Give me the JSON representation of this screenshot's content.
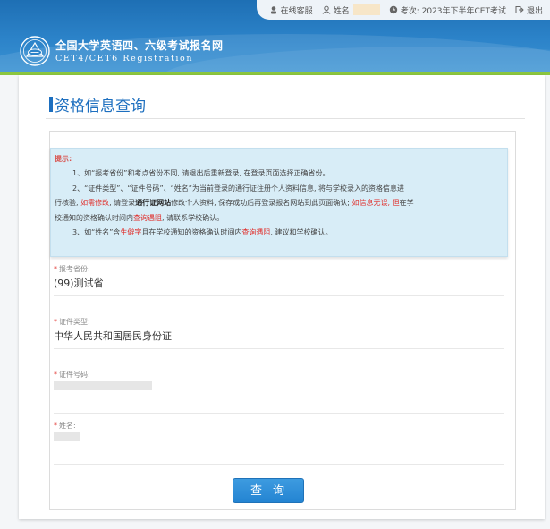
{
  "topbar": {
    "service_label": "在线客服",
    "name_label": "姓名",
    "exam_label": "考次: 2023年下半年CET考试",
    "logout_label": "退出"
  },
  "site": {
    "title_cn": "全国大学英语四、六级考试报名网",
    "title_en": "CET4/CET6  Registration"
  },
  "page": {
    "title": "资格信息查询"
  },
  "notice": {
    "heading": "提示:",
    "line1": "1、如“报考省份”和考点省份不同, 请退出后重新登录, 在登录页面选择正确省份。",
    "line2_a": "2、“证件类型”、“证件号码”、“姓名”为当前登录的通行证注册个人资料信息, 将与学校录入的资格信息进",
    "line2_b": "行核验, ",
    "line2_red1": "如需修改",
    "line2_c": ", 请登录",
    "line2_bold": "通行证网站",
    "line2_d": "修改个人资料, 保存成功后再登录报名网站到此页面确认; ",
    "line2_red2": "如信息无误, 但",
    "line2_e": "在学",
    "line2_f": "校通知的资格确认时间内",
    "line2_red3": "查询遇阻",
    "line2_g": ", 请联系学校确认。",
    "line3_a": "3、如“姓名”含",
    "line3_red1": "生僻字",
    "line3_b": "且在学校通知的资格确认时间内",
    "line3_red2": "查询遇阻",
    "line3_c": ", 建议和学校确认。"
  },
  "form": {
    "required_mark": "*",
    "province_label": "报考省份:",
    "province_value": "(99)测试省",
    "id_type_label": "证件类型:",
    "id_type_value": "中华人民共和国居民身份证",
    "id_number_label": "证件号码:",
    "name_label": "姓名:",
    "query_button": "查询"
  },
  "colors": {
    "header_blue": "#2c83c9",
    "accent_green": "#8cc63f",
    "title_blue": "#1d6fbf",
    "alert_red": "#e0302c"
  }
}
